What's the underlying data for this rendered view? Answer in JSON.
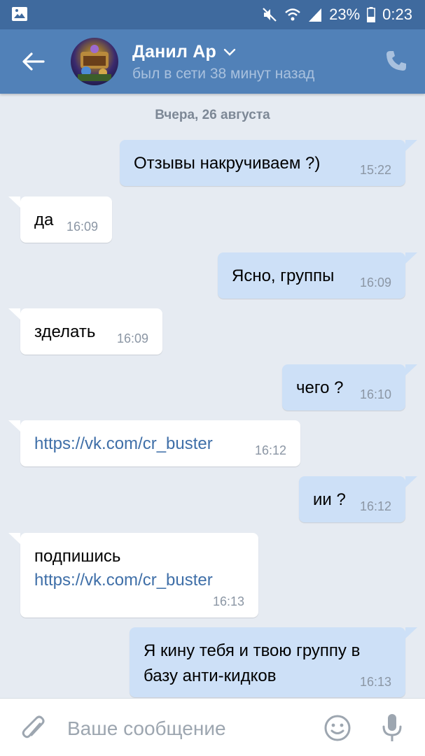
{
  "status_bar": {
    "battery": "23%",
    "time": "0:23",
    "icons": [
      "image-icon",
      "mute-icon",
      "wifi-icon",
      "signal-icon",
      "battery-icon"
    ]
  },
  "header": {
    "name": "Данил Ар",
    "status": "был в сети 38 минут назад",
    "icons": [
      "back-arrow-icon",
      "chevron-down-icon",
      "phone-icon"
    ]
  },
  "chat": {
    "date": "Вчера, 26 августа",
    "messages": [
      {
        "dir": "out",
        "text": "Отзывы накручиваем ?)",
        "time": "15:22"
      },
      {
        "dir": "in",
        "text": "да",
        "time": "16:09"
      },
      {
        "dir": "out",
        "text": "Ясно, группы",
        "time": "16:09"
      },
      {
        "dir": "in",
        "text": "зделать",
        "time": "16:09"
      },
      {
        "dir": "out",
        "text": "чего ?",
        "time": "16:10"
      },
      {
        "dir": "in",
        "link": "https://vk.com/cr_buster",
        "time": "16:12"
      },
      {
        "dir": "out",
        "text": "ии ?",
        "time": "16:12"
      },
      {
        "dir": "in",
        "text": "подпишись",
        "link": "https://vk.com/cr_buster",
        "time": "16:13"
      },
      {
        "dir": "out",
        "line1": "Я кину тебя и твою группу в",
        "line2": "базу анти-кидков",
        "time": "16:13"
      }
    ]
  },
  "input": {
    "placeholder": "Ваше сообщение",
    "icons": [
      "attach-icon",
      "emoji-icon",
      "microphone-icon"
    ]
  },
  "colors": {
    "header_bg": "#5181b8",
    "status_bar_bg": "#3f6a9e",
    "chat_bg": "#e6ebf2",
    "outgoing_bubble": "#cde0f7",
    "incoming_bubble": "#ffffff",
    "link": "#3f6fa8"
  }
}
